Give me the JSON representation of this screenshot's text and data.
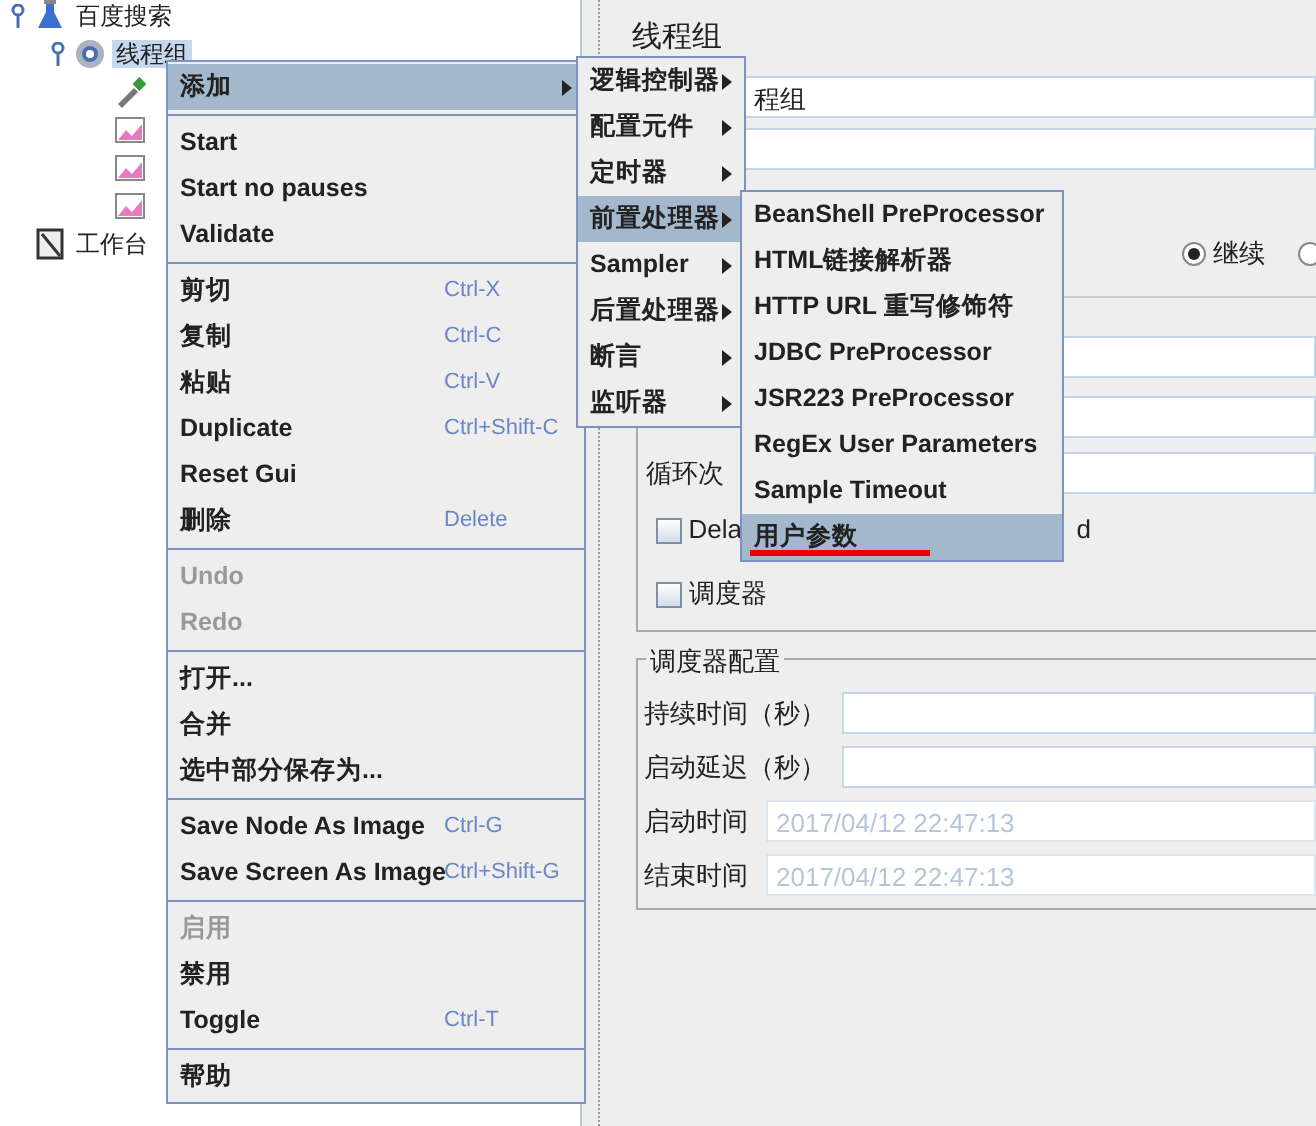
{
  "tree": [
    {
      "label": "百度搜索",
      "kind": "flask",
      "selected": false,
      "expanded": true,
      "children": [
        {
          "label": "线程组",
          "kind": "gear",
          "selected": true,
          "expanded": true,
          "children": [
            {
              "kind": "dropper"
            },
            {
              "kind": "chart"
            },
            {
              "kind": "chart"
            },
            {
              "kind": "chart"
            }
          ]
        }
      ]
    },
    {
      "label": "工作台",
      "kind": "notebook",
      "selected": false
    }
  ],
  "panel": {
    "title": "线程组",
    "name_value": "程组",
    "radios": [
      {
        "label": "继续",
        "selected": true
      },
      {
        "selected": false
      }
    ],
    "loop_label": "循环次",
    "delay": {
      "label": "Dela",
      "tail": "d",
      "checked": false
    },
    "scheduler": {
      "label": "调度器",
      "checked": false
    },
    "scheduler_config": {
      "title": "调度器配置",
      "fields": [
        {
          "label": "持续时间（秒）",
          "disabled": false
        },
        {
          "label": "启动延迟（秒）",
          "disabled": false
        },
        {
          "label": "启动时间",
          "value": "2017/04/12 22:47:13",
          "disabled": true
        },
        {
          "label": "结束时间",
          "value": "2017/04/12 22:47:13",
          "disabled": true
        }
      ]
    }
  },
  "context_menu": {
    "sections": [
      [
        {
          "label": "添加",
          "submenu": true,
          "selected": true
        }
      ],
      [
        {
          "label": "Start"
        },
        {
          "label": "Start no pauses"
        },
        {
          "label": "Validate"
        }
      ],
      [
        {
          "label": "剪切",
          "shortcut": "Ctrl-X"
        },
        {
          "label": "复制",
          "shortcut": "Ctrl-C"
        },
        {
          "label": "粘贴",
          "shortcut": "Ctrl-V"
        },
        {
          "label": "Duplicate",
          "shortcut": "Ctrl+Shift-C"
        },
        {
          "label": "Reset Gui"
        },
        {
          "label": "删除",
          "shortcut": "Delete"
        }
      ],
      [
        {
          "label": "Undo",
          "disabled": true
        },
        {
          "label": "Redo",
          "disabled": true
        }
      ],
      [
        {
          "label": "打开..."
        },
        {
          "label": "合并"
        },
        {
          "label": "选中部分保存为..."
        }
      ],
      [
        {
          "label": "Save Node As Image",
          "shortcut": "Ctrl-G"
        },
        {
          "label": "Save Screen As Image",
          "shortcut": "Ctrl+Shift-G"
        }
      ],
      [
        {
          "label": "启用",
          "disabled": true
        },
        {
          "label": "禁用"
        },
        {
          "label": "Toggle",
          "shortcut": "Ctrl-T"
        }
      ],
      [
        {
          "label": "帮助"
        }
      ]
    ]
  },
  "add_submenu": [
    {
      "label": "逻辑控制器",
      "selected": false
    },
    {
      "label": "配置元件",
      "selected": false
    },
    {
      "label": "定时器",
      "selected": false
    },
    {
      "label": "前置处理器",
      "selected": true
    },
    {
      "label": "Sampler",
      "selected": false
    },
    {
      "label": "后置处理器",
      "selected": false
    },
    {
      "label": "断言",
      "selected": false
    },
    {
      "label": "监听器",
      "selected": false
    }
  ],
  "preprocessor_submenu": [
    {
      "label": "BeanShell PreProcessor",
      "selected": false
    },
    {
      "label": "HTML链接解析器",
      "selected": false
    },
    {
      "label": "HTTP URL 重写修饰符",
      "selected": false
    },
    {
      "label": "JDBC PreProcessor",
      "selected": false
    },
    {
      "label": "JSR223 PreProcessor",
      "selected": false
    },
    {
      "label": "RegEx User Parameters",
      "selected": false
    },
    {
      "label": "Sample Timeout",
      "selected": false
    },
    {
      "label": "用户参数",
      "selected": true,
      "underlined": true
    }
  ]
}
